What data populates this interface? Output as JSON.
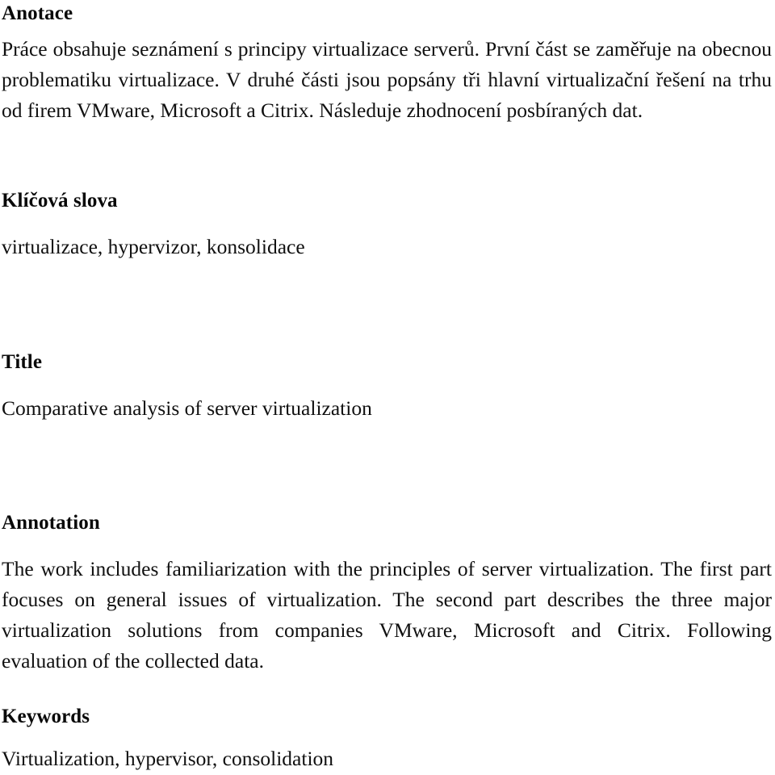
{
  "document": {
    "language_sections": [
      "cs",
      "en"
    ],
    "background_color": "#ffffff",
    "text_color": "#101010"
  },
  "sections": {
    "anotace": {
      "heading": "Anotace",
      "body": "Práce obsahuje seznámení s principy virtualizace serverů. První část se zaměřuje na obecnou problematiku virtualizace. V druhé části jsou popsány tři hlavní virtualizační řešení na trhu od firem VMware, Microsoft a Citrix. Následuje zhodnocení posbíraných dat."
    },
    "klicova_slova": {
      "heading": "Klíčová slova",
      "body": "virtualizace, hypervizor, konsolidace"
    },
    "title": {
      "heading": "Title",
      "body": "Comparative analysis of server virtualization"
    },
    "annotation": {
      "heading": "Annotation",
      "body": "The work includes familiarization with the principles of server virtualization. The first part focuses on general issues of virtualization. The second part describes the three major virtualization solutions from companies VMware, Microsoft and Citrix. Following evaluation of the collected data."
    },
    "keywords": {
      "heading": "Keywords",
      "body": "Virtualization, hypervisor, consolidation"
    }
  }
}
